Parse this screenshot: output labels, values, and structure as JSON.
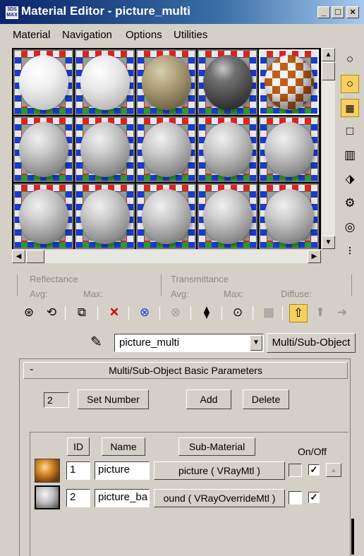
{
  "window": {
    "title": "Material Editor - picture_multi",
    "app_icon_text": "3DS\nMAX",
    "controls": [
      "_",
      "□",
      "×"
    ]
  },
  "menu": [
    "Material",
    "Navigation",
    "Options",
    "Utilities"
  ],
  "sample_slots": [
    {
      "id": 1,
      "type": "white-sphere"
    },
    {
      "id": 2,
      "type": "white-rough-sphere"
    },
    {
      "id": 3,
      "type": "stone-sphere"
    },
    {
      "id": 4,
      "type": "dark-glossy-sphere"
    },
    {
      "id": 5,
      "type": "checker-sphere",
      "selected": true
    },
    {
      "id": 6,
      "type": "default"
    },
    {
      "id": 7,
      "type": "default"
    },
    {
      "id": 8,
      "type": "default"
    },
    {
      "id": 9,
      "type": "default"
    },
    {
      "id": 10,
      "type": "default"
    },
    {
      "id": 11,
      "type": "default"
    },
    {
      "id": 12,
      "type": "default"
    },
    {
      "id": 13,
      "type": "default"
    },
    {
      "id": 14,
      "type": "default"
    },
    {
      "id": 15,
      "type": "default"
    }
  ],
  "right_toolbar": [
    "sample-type-icon",
    "backlight-icon",
    "background-icon",
    "uv-tiling-icon",
    "video-color-check-icon",
    "make-preview-icon",
    "options-icon",
    "select-by-material-icon",
    "material-map-navigator-icon"
  ],
  "reflectance": {
    "reflectance_label": "Reflectance",
    "transmittance_label": "Transmittance",
    "avg1": "Avg:",
    "max1": "Max:",
    "avg2": "Avg:",
    "max2": "Max:",
    "diffuse": "Diffuse:"
  },
  "bottom_toolbar": [
    "get-material-icon",
    "put-to-scene-icon",
    "assign-to-selection-icon",
    "reset-icon",
    "make-copy-icon",
    "make-unique-icon",
    "put-to-library-icon",
    "material-id-icon",
    "show-map-icon",
    "show-end-result-icon",
    "go-to-parent-icon",
    "go-forward-icon"
  ],
  "material_name": "picture_multi",
  "material_type_button": "Multi/Sub-Object",
  "rollout": {
    "collapse": "-",
    "title": "Multi/Sub-Object Basic Parameters",
    "number": "2",
    "set_number": "Set Number",
    "add": "Add",
    "delete": "Delete",
    "headers": {
      "id": "ID",
      "name": "Name",
      "sub_material": "Sub-Material",
      "on_off": "On/Off"
    },
    "rows": [
      {
        "id": "1",
        "name": "picture",
        "sub_material": "picture  ( VRayMtl )",
        "on": true
      },
      {
        "id": "2",
        "name": "picture_ba",
        "sub_material": "ound  ( VRayOverrideMtl )",
        "on": true
      }
    ]
  }
}
